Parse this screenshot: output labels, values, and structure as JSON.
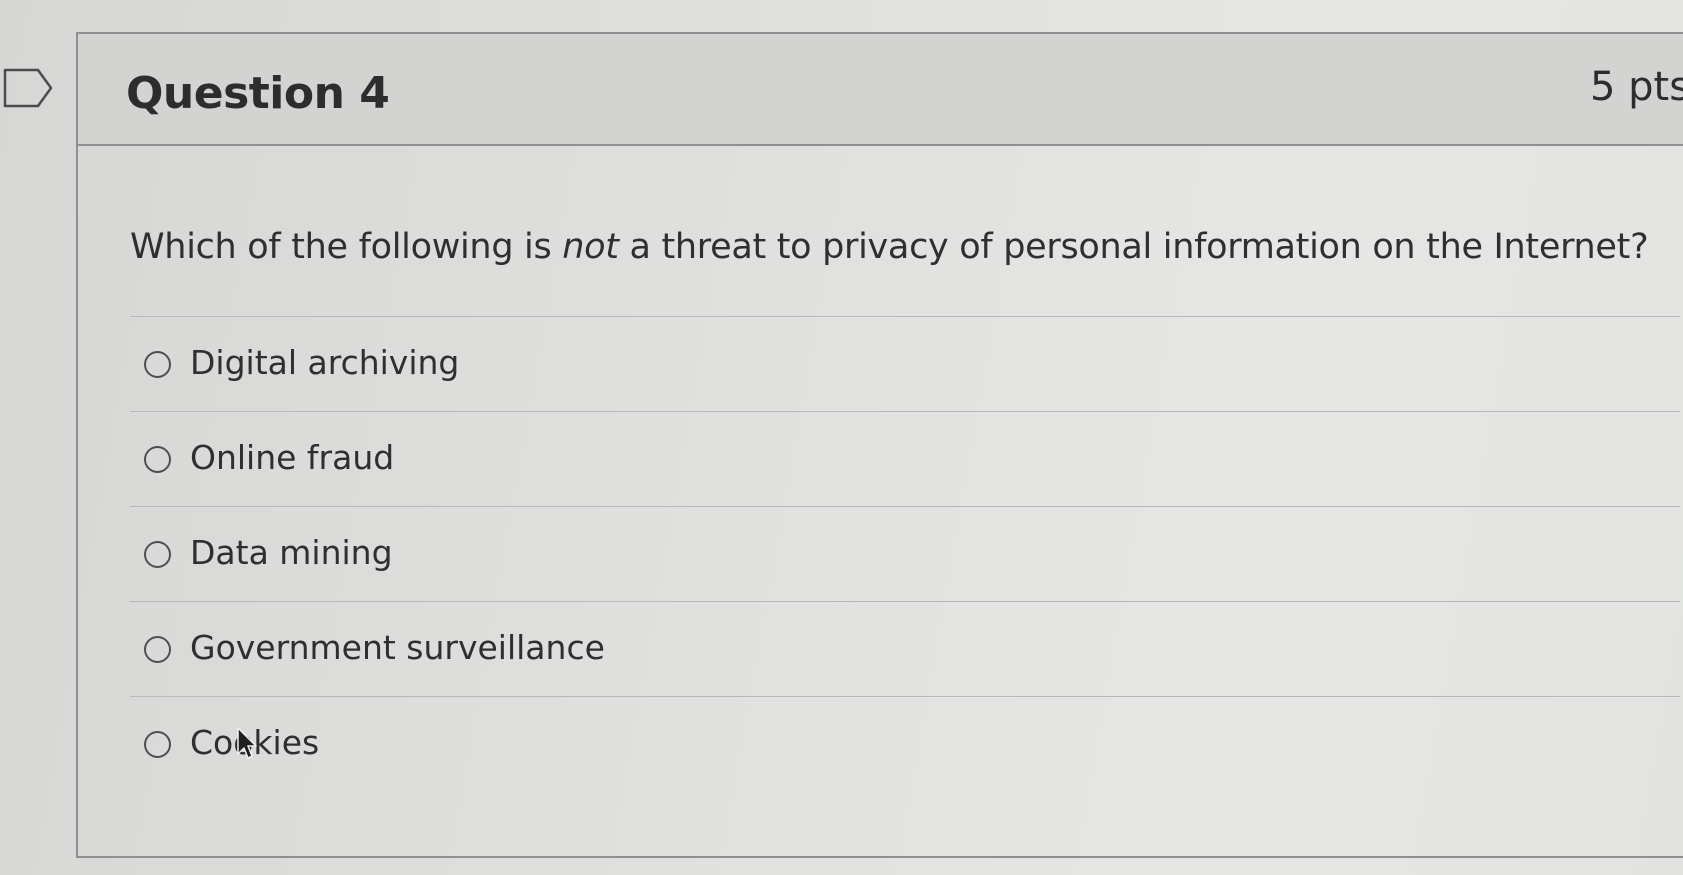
{
  "question": {
    "title": "Question 4",
    "points": "5 pts",
    "text_before": "Which of the following is ",
    "text_emphasis": "not",
    "text_after": " a threat to privacy of personal information on the Internet?"
  },
  "answers": [
    {
      "label": "Digital archiving",
      "selected": false
    },
    {
      "label": "Online fraud",
      "selected": false
    },
    {
      "label": "Data mining",
      "selected": false
    },
    {
      "label": "Government surveillance",
      "selected": false
    },
    {
      "label": "Cookies",
      "selected": false
    }
  ],
  "icons": {
    "flag": "flag-bookmark-icon",
    "cursor": "mouse-pointer-icon"
  },
  "colors": {
    "text": "#2d2f31",
    "header_bg": "#d3d4d2",
    "border": "#8f9190"
  }
}
